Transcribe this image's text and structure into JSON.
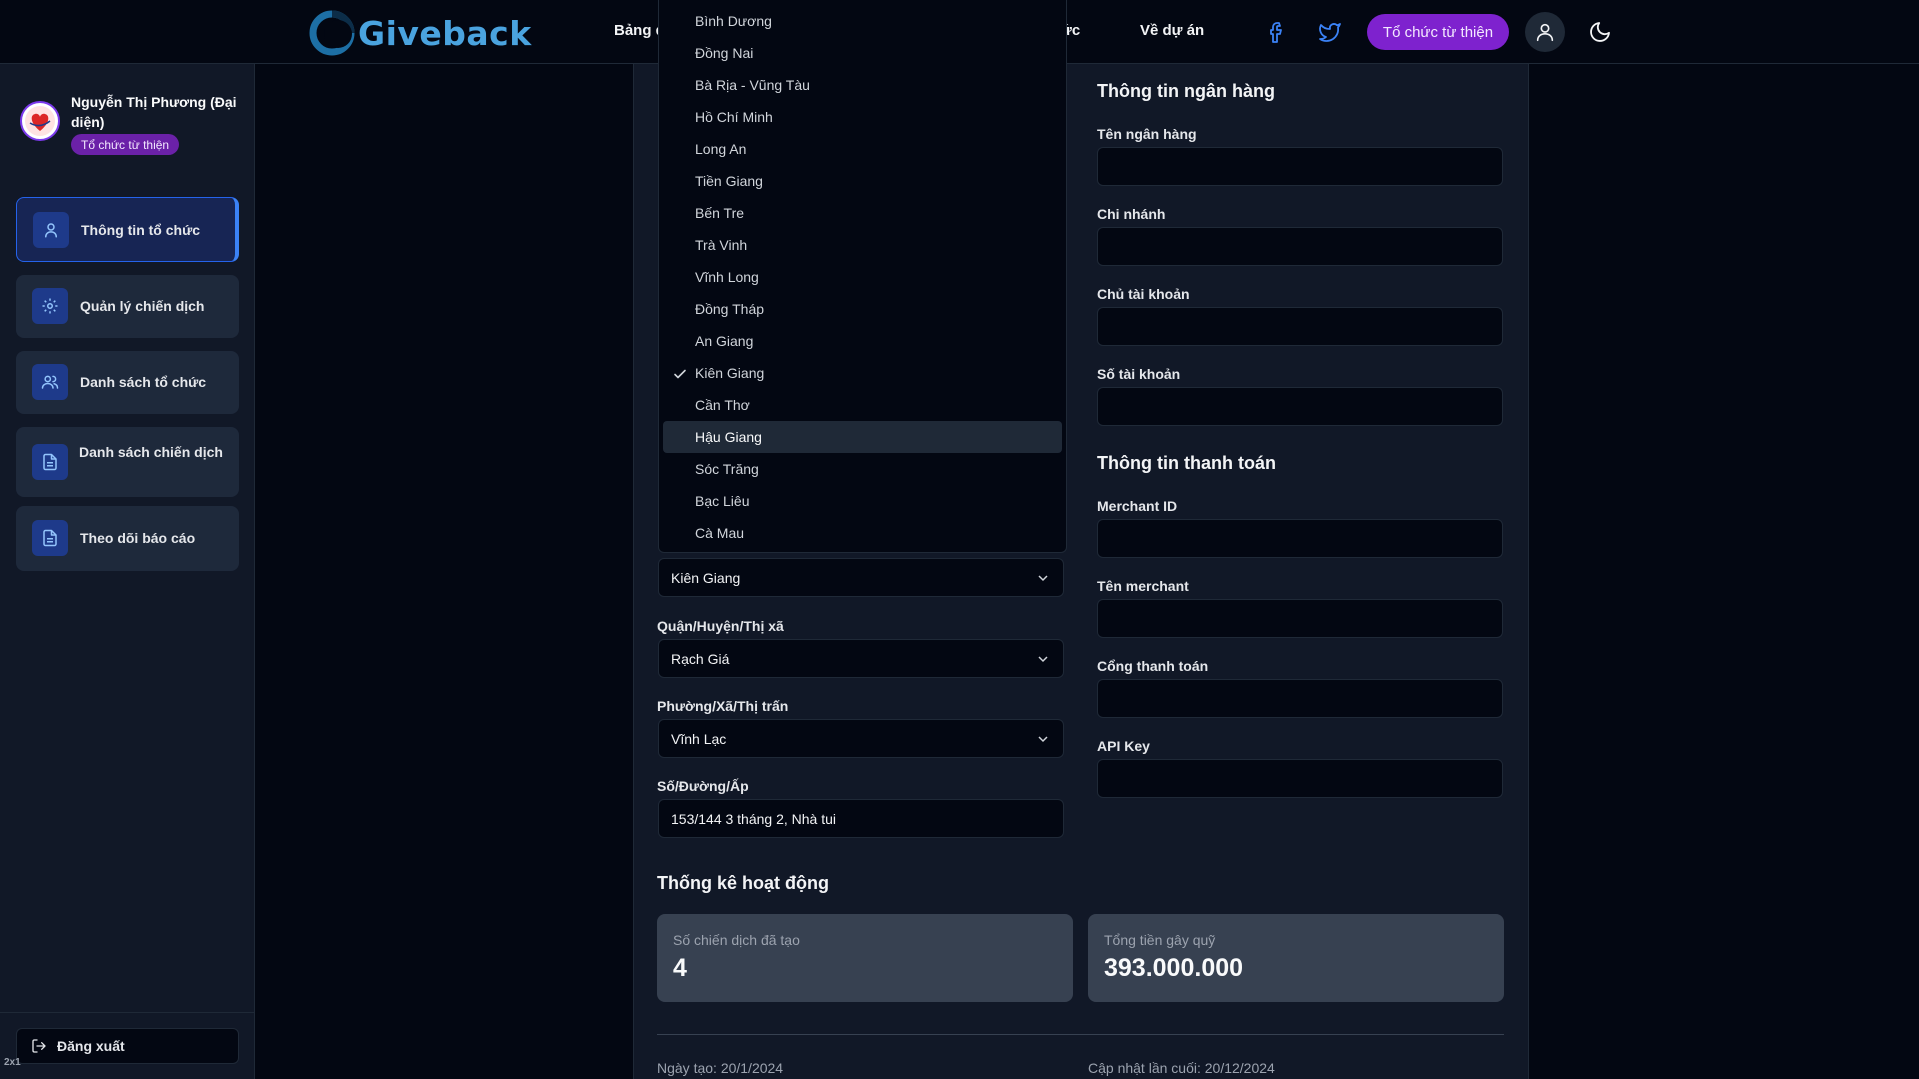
{
  "header": {
    "logo_text": "Giveback",
    "nav": [
      "Bảng đ",
      "ức",
      "Về dự án"
    ],
    "org_button": "Tổ chức từ thiện",
    "icons": [
      "facebook-icon",
      "twitter-icon",
      "user-icon",
      "moon-icon"
    ]
  },
  "sidebar": {
    "profile_name": "Nguyễn Thị Phương (Đại diện)",
    "profile_badge": "Tổ chức từ thiện",
    "items": [
      {
        "label": "Thông tin tổ chức",
        "icon": "user-icon"
      },
      {
        "label": "Quản lý chiến dịch",
        "icon": "gear-icon"
      },
      {
        "label": "Danh sách tổ chức",
        "icon": "users-icon"
      },
      {
        "label": "Danh sách chiến dịch",
        "icon": "document-icon"
      },
      {
        "label": "Theo dõi báo cáo",
        "icon": "document-icon"
      }
    ],
    "logout": "Đăng xuất",
    "corner_tag": "2x1"
  },
  "province_dropdown": {
    "options": [
      "Bình Dương",
      "Đồng Nai",
      "Bà Rịa - Vũng Tàu",
      "Hồ Chí Minh",
      "Long An",
      "Tiền Giang",
      "Bến Tre",
      "Trà Vinh",
      "Vĩnh Long",
      "Đồng Tháp",
      "An Giang",
      "Kiên Giang",
      "Cần Thơ",
      "Hậu Giang",
      "Sóc Trăng",
      "Bạc Liêu",
      "Cà Mau"
    ],
    "selected": "Kiên Giang",
    "highlighted": "Hậu Giang"
  },
  "address": {
    "province_value": "Kiên Giang",
    "district_label": "Quận/Huyện/Thị xã",
    "district_value": "Rạch Giá",
    "ward_label": "Phường/Xã/Thị trấn",
    "ward_value": "Vĩnh Lạc",
    "street_label": "Số/Đường/Ấp",
    "street_value": "153/144 3 tháng 2, Nhà tui"
  },
  "bank": {
    "title": "Thông tin ngân hàng",
    "bank_name_label": "Tên ngân hàng",
    "branch_label": "Chi nhánh",
    "account_holder_label": "Chủ tài khoản",
    "account_number_label": "Số tài khoản"
  },
  "payment": {
    "title": "Thông tin thanh toán",
    "merchant_id_label": "Merchant ID",
    "merchant_name_label": "Tên merchant",
    "gateway_label": "Cổng thanh toán",
    "api_key_label": "API Key"
  },
  "stats": {
    "title": "Thống kê hoạt động",
    "campaigns_label": "Số chiến dịch đã tạo",
    "campaigns_value": "4",
    "funds_label": "Tổng tiền gây quỹ",
    "funds_value": "393.000.000"
  },
  "meta": {
    "created": "Ngày tạo: 20/1/2024",
    "updated": "Cập nhật lần cuối: 20/12/2024"
  },
  "colors": {
    "background": "#030712",
    "panel": "#111827",
    "accent_purple": "#7e22ce",
    "accent_blue": "#3b82f6",
    "logo_blue": "#4aa3df"
  }
}
